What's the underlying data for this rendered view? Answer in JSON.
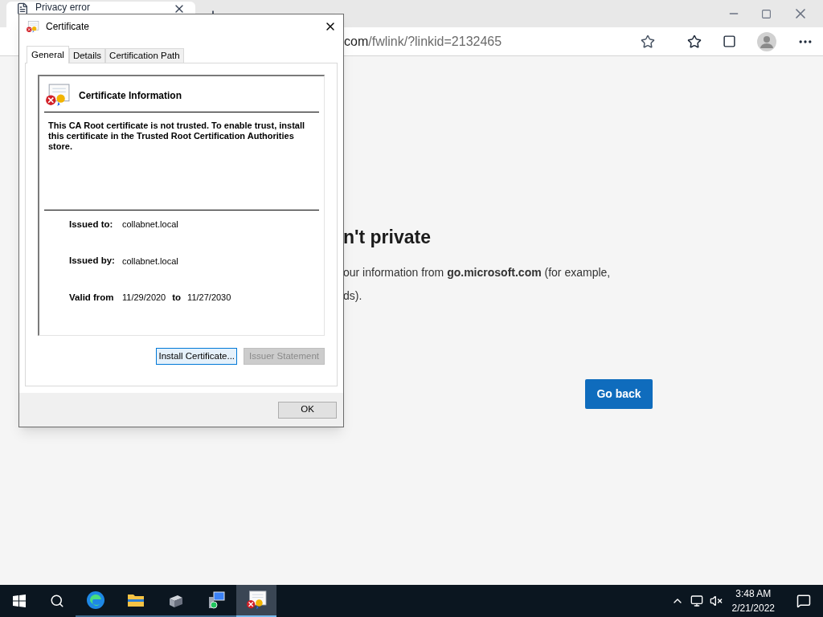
{
  "browser": {
    "tab": {
      "title": "Privacy error"
    },
    "address": {
      "host": "com",
      "path": "/fwlink/?linkid=2132465"
    },
    "page": {
      "heading": "n't private",
      "lines": [
        "our information from **go.microsoft.com** (for example,",
        "ds)."
      ],
      "button": "Go back"
    }
  },
  "dialog": {
    "title": "Certificate",
    "tabs": [
      {
        "label": "General",
        "selected": true
      },
      {
        "label": "Details",
        "selected": false
      },
      {
        "label": "Certification Path",
        "selected": false
      }
    ],
    "info_title": "Certificate Information",
    "message": "This CA Root certificate is not trusted. To enable trust, install this certificate in the Trusted Root Certification Authorities store.",
    "issued_to": {
      "label": "Issued to:",
      "value": "collabnet.local"
    },
    "issued_by": {
      "label": "Issued by:",
      "value": "collabnet.local"
    },
    "valid": {
      "label": "Valid from",
      "from": "11/29/2020",
      "to_label": "to",
      "to": "11/27/2030"
    },
    "buttons": [
      {
        "label": "Install Certificate...",
        "disabled": false,
        "focused": true
      },
      {
        "label": "Issuer Statement",
        "disabled": true,
        "focused": false
      }
    ],
    "ok": "OK"
  },
  "taskbar": {
    "apps": [
      {
        "kind": "edge",
        "selected": false
      },
      {
        "kind": "folder",
        "selected": false
      },
      {
        "kind": "server",
        "selected": false
      },
      {
        "kind": "computer",
        "selected": false
      },
      {
        "kind": "certificate",
        "selected": true
      }
    ],
    "time": "3:48 AM",
    "date": "2/21/2022"
  }
}
